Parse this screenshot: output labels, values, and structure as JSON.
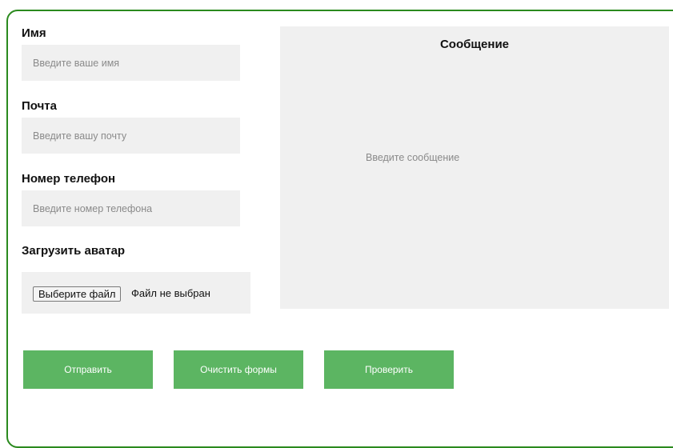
{
  "form": {
    "name": {
      "label": "Имя",
      "placeholder": "Введите ваше имя",
      "value": ""
    },
    "email": {
      "label": "Почта",
      "placeholder": "Введите вашу почту",
      "value": ""
    },
    "phone": {
      "label": "Номер телефон",
      "placeholder": "Введите номер телефона",
      "value": ""
    },
    "avatar": {
      "label": "Загрузить аватар",
      "button_label": "Выберите файл",
      "status": "Файл не выбран"
    },
    "message": {
      "label": "Сообщение",
      "placeholder": "Введите сообщение",
      "value": ""
    }
  },
  "buttons": {
    "submit": "Отправить",
    "clear": "Очистить формы",
    "check": "Проверить"
  },
  "colors": {
    "frame_border": "#2b8a1e",
    "button_bg": "#5cb562",
    "field_bg": "#f0f0f0"
  }
}
